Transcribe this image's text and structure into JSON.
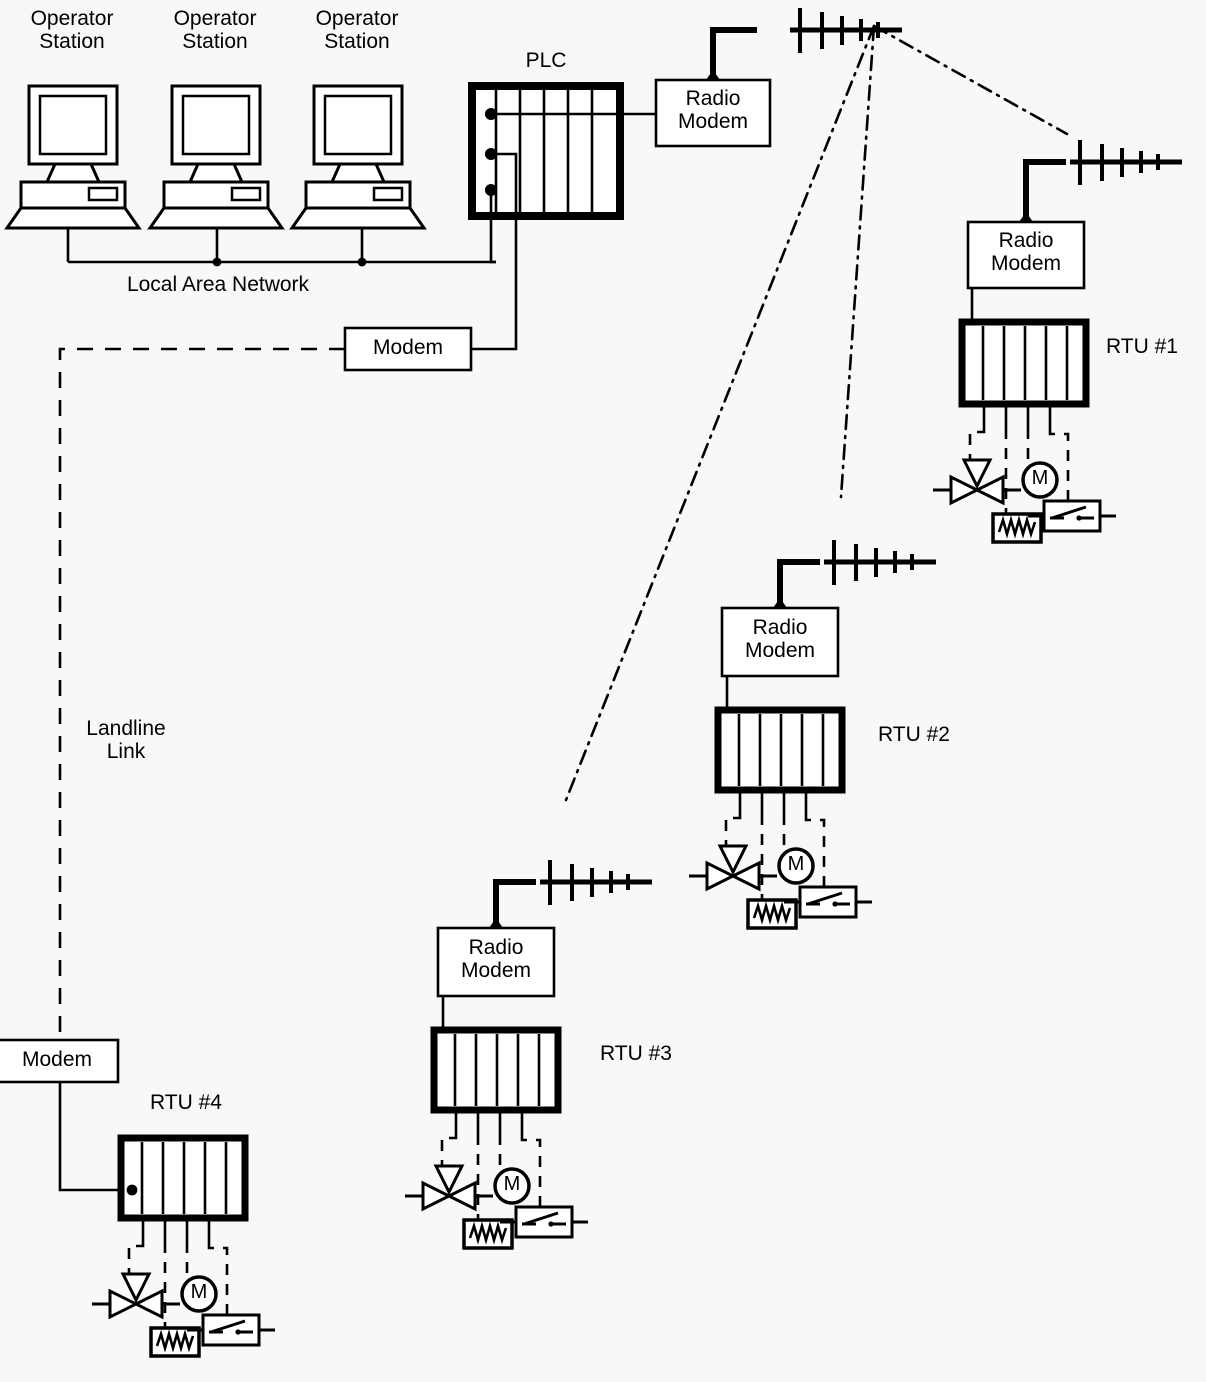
{
  "diagram": {
    "title": "SCADA system architecture with PLC master and four remote terminal units",
    "colors": {
      "background": "#f8f8f8",
      "stroke": "#000000",
      "fill": "#ffffff"
    }
  },
  "control_room": {
    "operator_stations": [
      {
        "label": "Operator\nStation"
      },
      {
        "label": "Operator\nStation"
      },
      {
        "label": "Operator\nStation"
      }
    ],
    "network_label": "Local Area Network",
    "plc_label": "PLC",
    "plc_slots": 6,
    "plc_terminals": 3,
    "radio_modem_label": "Radio\nModem",
    "modem_label": "Modem"
  },
  "landline": {
    "label": "Landline\nLink",
    "remote_modem_label": "Modem"
  },
  "rtus": [
    {
      "name": "RTU #1",
      "radio_modem_label": "Radio\nModem",
      "link_type": "radio",
      "slots": 6,
      "field_devices": [
        {
          "name": "control-valve",
          "symbol": "valve"
        },
        {
          "name": "heater-element",
          "symbol": "resistor"
        },
        {
          "name": "motor",
          "symbol": "M"
        },
        {
          "name": "limit-switch",
          "symbol": "switch"
        }
      ]
    },
    {
      "name": "RTU #2",
      "radio_modem_label": "Radio\nModem",
      "link_type": "radio",
      "slots": 6,
      "field_devices": [
        {
          "name": "control-valve",
          "symbol": "valve"
        },
        {
          "name": "heater-element",
          "symbol": "resistor"
        },
        {
          "name": "motor",
          "symbol": "M"
        },
        {
          "name": "limit-switch",
          "symbol": "switch"
        }
      ]
    },
    {
      "name": "RTU #3",
      "radio_modem_label": "Radio\nModem",
      "link_type": "radio",
      "slots": 6,
      "field_devices": [
        {
          "name": "control-valve",
          "symbol": "valve"
        },
        {
          "name": "heater-element",
          "symbol": "resistor"
        },
        {
          "name": "motor",
          "symbol": "M"
        },
        {
          "name": "limit-switch",
          "symbol": "switch"
        }
      ]
    },
    {
      "name": "RTU #4",
      "radio_modem_label": null,
      "link_type": "landline",
      "slots": 6,
      "field_devices": [
        {
          "name": "control-valve",
          "symbol": "valve"
        },
        {
          "name": "heater-element",
          "symbol": "resistor"
        },
        {
          "name": "motor",
          "symbol": "M"
        },
        {
          "name": "limit-switch",
          "symbol": "switch"
        }
      ]
    }
  ],
  "motor_symbol_text": "M"
}
